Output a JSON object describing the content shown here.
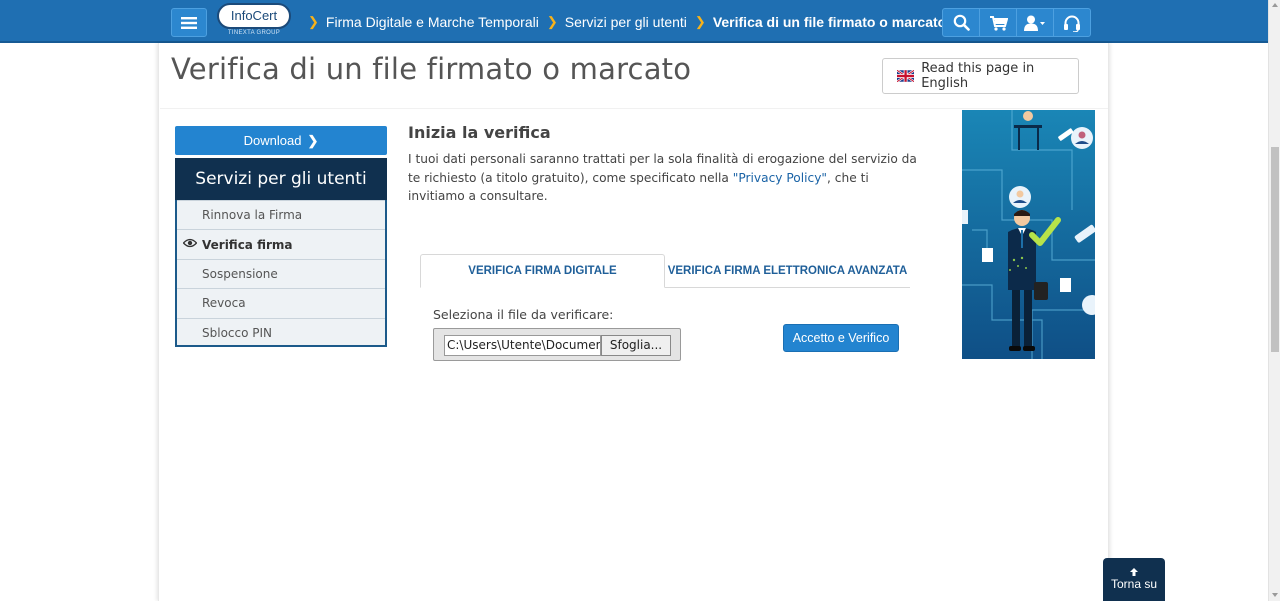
{
  "navbar": {
    "menu_icon": "hamburger-icon",
    "logo": {
      "brand": "InfoCert",
      "tagline": "TINEXTA GROUP"
    },
    "breadcrumb": [
      "Firma Digitale e Marche Temporali",
      "Servizi per gli utenti",
      "Verifica di un file firmato o marcato"
    ],
    "breadcrumb_separator": "❯",
    "icons": [
      "search-icon",
      "cart-icon",
      "user-icon",
      "headset-icon"
    ]
  },
  "page": {
    "title": "Verifica di un file firmato o marcato",
    "english_button": "Read this page in English"
  },
  "sidebar": {
    "download_label": "Download",
    "panel_title": "Servizi per gli utenti",
    "items": [
      {
        "label": "Rinnova la Firma",
        "active": false
      },
      {
        "label": "Verifica firma",
        "active": true
      },
      {
        "label": "Sospensione",
        "active": false
      },
      {
        "label": "Revoca",
        "active": false
      },
      {
        "label": "Sblocco PIN",
        "active": false
      }
    ]
  },
  "main": {
    "section_title": "Inizia la verifica",
    "privacy_before": "I tuoi dati personali saranno trattati per la sola finalità di erogazione del servizio da te richiesto (a titolo gratuito), come specificato nella ",
    "privacy_link": "\"Privacy Policy\"",
    "privacy_after": ", che ti invitiamo a consultare.",
    "tabs": [
      {
        "label": "VERIFICA FIRMA DIGITALE",
        "active": true
      },
      {
        "label": "VERIFICA FIRMA ELETTRONICA AVANZATA",
        "active": false
      }
    ],
    "file_label": "Seleziona il file da verificare:",
    "file_value": "C:\\Users\\Utente\\Documents",
    "browse_label": "Sfoglia...",
    "verify_label": "Accetto e Verifico"
  },
  "back_to_top": "Torna su",
  "colors": {
    "navbar": "#1f6fb2",
    "accent": "#2384d0",
    "sidebar_head": "#10304f",
    "breadcrumb_separator": "#f7b21a"
  }
}
